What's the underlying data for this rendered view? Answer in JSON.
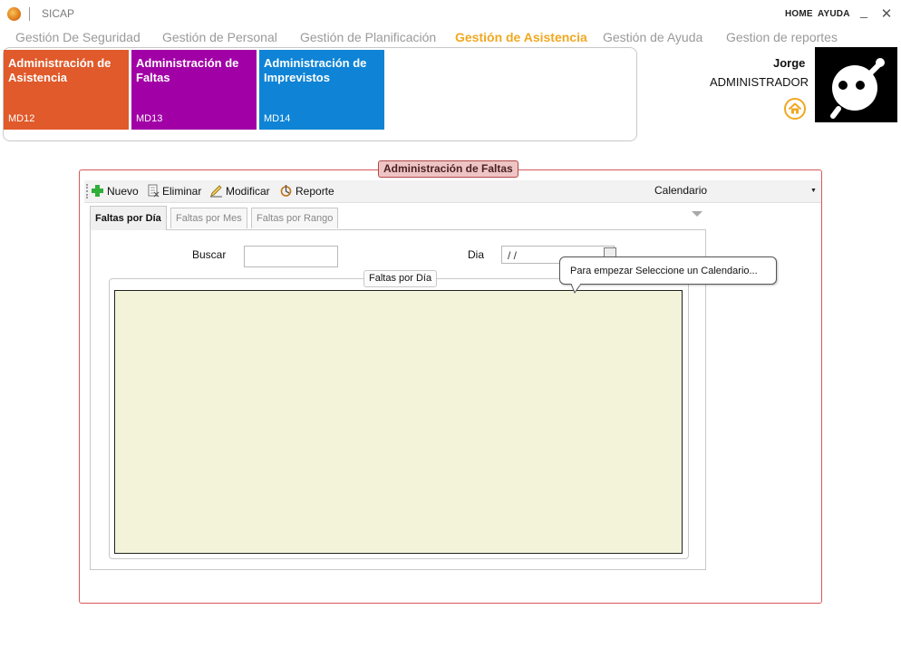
{
  "window": {
    "title": "SICAP",
    "top_links": [
      "HOME",
      "AYUDA"
    ],
    "minimize_glyph": "_",
    "close_glyph": "✕"
  },
  "menu": {
    "items": [
      {
        "label": "Gestión De Seguridad"
      },
      {
        "label": "Gestión de Personal"
      },
      {
        "label": "Gestión de Planificación"
      },
      {
        "label": "Gestión de Asistencia",
        "active": true
      },
      {
        "label": "Gestión de Ayuda"
      },
      {
        "label": "Gestion de reportes"
      }
    ],
    "active_color": "#f0a820",
    "inactive_color": "#9a9a9a"
  },
  "tiles": [
    {
      "title": "Administración de Asistencia",
      "code": "MD12",
      "color": "#e05a2b"
    },
    {
      "title": "Administración de Faltas",
      "code": "MD13",
      "color": "#a100a6"
    },
    {
      "title": "Administración de Imprevistos",
      "code": "MD14",
      "color": "#0f84d6"
    }
  ],
  "user": {
    "name": "Jorge",
    "role": "ADMINISTRADOR",
    "home_icon": "home-icon",
    "avatar_icon": "avatar-icon"
  },
  "group": {
    "title": "Administración de Faltas"
  },
  "toolbar": {
    "nuevo": "Nuevo",
    "eliminar": "Eliminar",
    "modificar": "Modificar",
    "reporte": "Reporte",
    "calendar_combo": "Calendario"
  },
  "tabs": [
    {
      "label": "Faltas por Día",
      "active": true
    },
    {
      "label": "Faltas por Mes"
    },
    {
      "label": "Faltas por Rango"
    }
  ],
  "form": {
    "buscar_label": "Buscar",
    "buscar_value": "",
    "dia_label": "Dia",
    "dia_value": " /  /"
  },
  "tooltip": {
    "text": "Para empezar Seleccione un Calendario..."
  },
  "inner_group": {
    "title": "Faltas por Día"
  },
  "colors": {
    "group_border": "#d85858",
    "group_title_bg": "#efc4c4",
    "grid_bg": "#f3f3da"
  }
}
